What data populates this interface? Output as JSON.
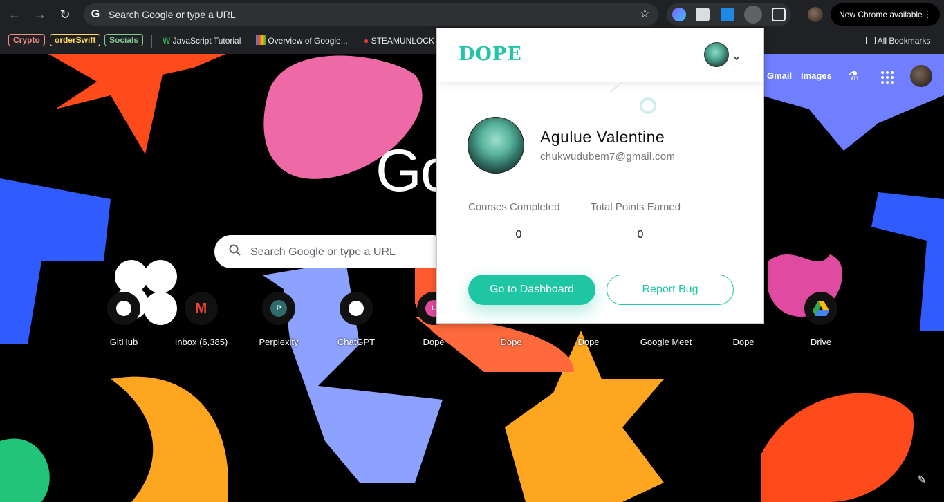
{
  "browser": {
    "omnibox_text": "Search Google or type a URL",
    "new_chrome_label": "New Chrome available",
    "bookmarks": [
      {
        "label": "Crypto",
        "color": "#f28b82"
      },
      {
        "label": "orderSwift",
        "color": "#fdd663"
      },
      {
        "label": "Socials",
        "color": "#81c995"
      },
      {
        "label": "JavaScript Tutorial"
      },
      {
        "label": "Overview of Google..."
      },
      {
        "label": "STEAMUNLOCK"
      },
      {
        "label": "All Bookmarks"
      }
    ]
  },
  "google": {
    "top_links": [
      "Gmail",
      "Images"
    ],
    "logo_partial": "Go",
    "search_placeholder": "Search Google or type a URL",
    "shortcuts": [
      {
        "label": "GitHub",
        "icon": "github-icon"
      },
      {
        "label": "Inbox (6,385)",
        "icon": "gmail-icon"
      },
      {
        "label": "Perplexity",
        "icon": "perplexity-icon",
        "glyph": "P"
      },
      {
        "label": "ChatGPT",
        "icon": "chatgpt-icon"
      },
      {
        "label": "Dope",
        "icon": "dope-icon",
        "glyph": "L"
      },
      {
        "label": "Dope",
        "icon": "dope-icon"
      },
      {
        "label": "Dope",
        "icon": "dope-icon"
      },
      {
        "label": "Google Meet",
        "icon": "meet-icon"
      },
      {
        "label": "Dope",
        "icon": "dope-icon"
      },
      {
        "label": "Drive",
        "icon": "drive-icon"
      }
    ]
  },
  "popup": {
    "logo": "DOPE",
    "user_name": "Agulue Valentine",
    "user_email": "chukwudubem7@gmail.com",
    "stats": [
      {
        "label": "Courses Completed",
        "value": "0"
      },
      {
        "label": "Total Points Earned",
        "value": "0"
      }
    ],
    "primary_button": "Go to Dashboard",
    "secondary_button": "Report Bug",
    "accent_color": "#1fc6a3"
  }
}
